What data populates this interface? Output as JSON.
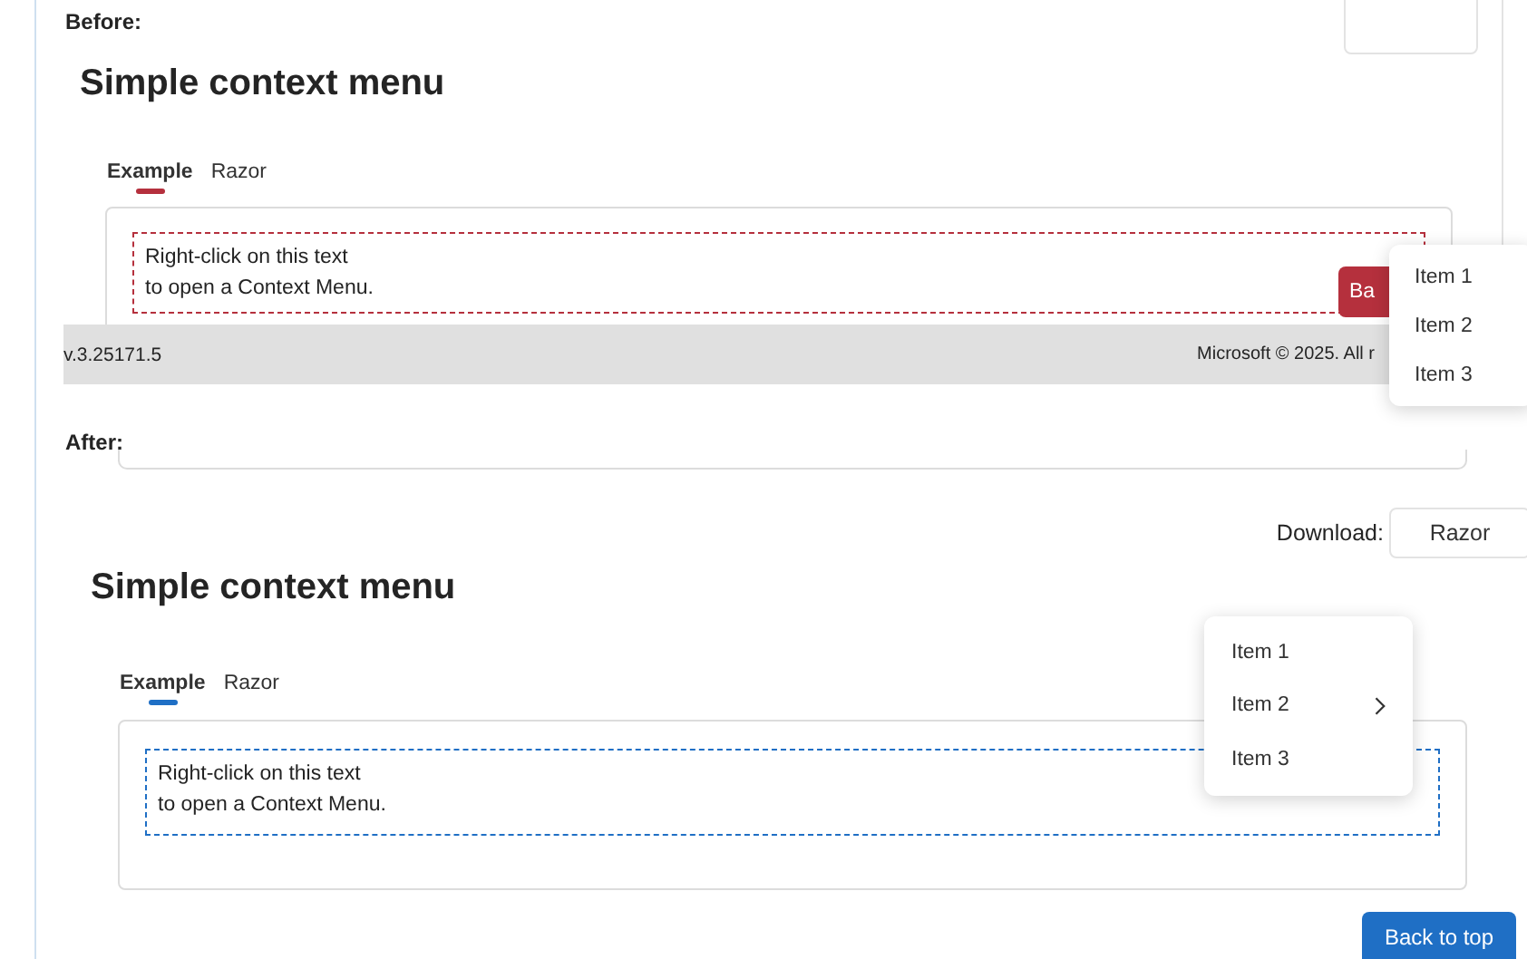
{
  "before": {
    "label": "Before:",
    "heading": "Simple context menu",
    "tabs": [
      {
        "label": "Example",
        "selected": true
      },
      {
        "label": "Razor",
        "selected": false
      }
    ],
    "demo_text": [
      "Right-click on this text",
      "to open a Context Menu."
    ],
    "back_button": "Ba",
    "footer": {
      "version": "v.3.25171.5",
      "copyright": "Microsoft © 2025. All r"
    },
    "context_menu": [
      {
        "label": "Item 1",
        "submenu": false
      },
      {
        "label": "Item 2",
        "submenu": false
      },
      {
        "label": "Item 3",
        "submenu": false
      }
    ]
  },
  "after": {
    "label": "After:",
    "heading": "Simple context menu",
    "download": {
      "label": "Download:",
      "button": "Razor"
    },
    "tabs": [
      {
        "label": "Example",
        "selected": true
      },
      {
        "label": "Razor",
        "selected": false
      }
    ],
    "demo_text": [
      "Right-click on this text",
      "to open a Context Menu."
    ],
    "context_menu": [
      {
        "label": "Item 1",
        "submenu": false
      },
      {
        "label": "Item 2",
        "submenu": true
      },
      {
        "label": "Item 3",
        "submenu": false
      }
    ],
    "back_button": "Back to top"
  }
}
